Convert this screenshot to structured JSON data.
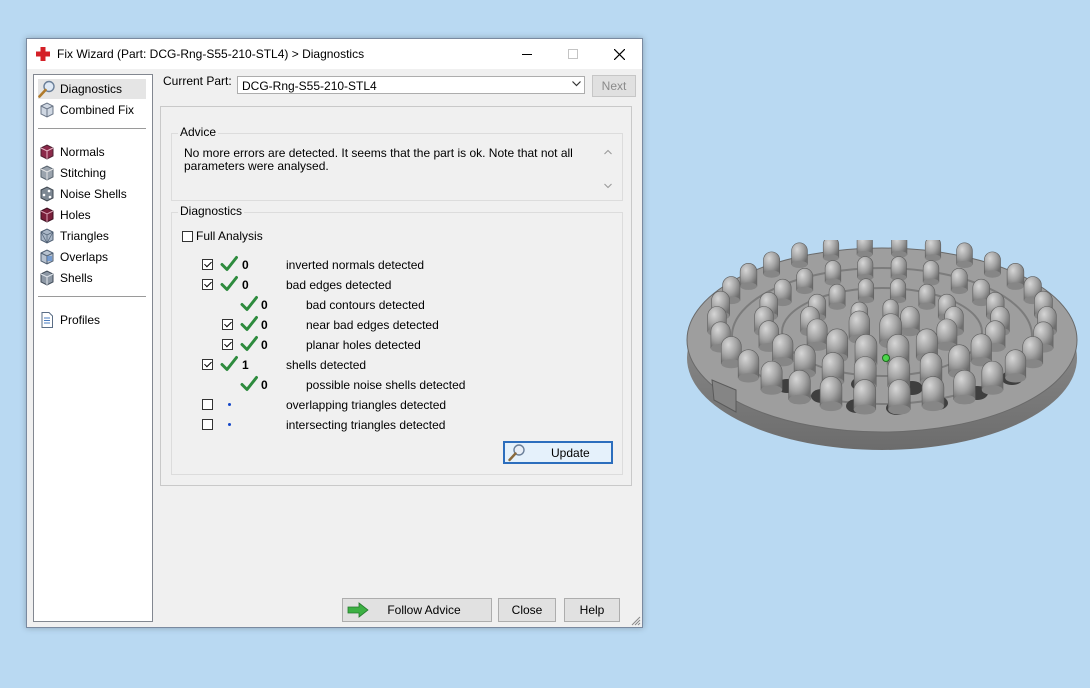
{
  "window": {
    "title": "Fix Wizard (Part: DCG-Rng-S55-210-STL4) > Diagnostics",
    "icon": "red-cross-icon",
    "controls": {
      "minimize": "minimize-icon",
      "maximize": "maximize-icon",
      "close": "close-icon"
    }
  },
  "sidebar": {
    "items": [
      {
        "label": "Diagnostics",
        "icon": "magnifier-icon",
        "selected": true
      },
      {
        "label": "Combined Fix",
        "icon": "cube-icon"
      },
      {
        "label": "Normals",
        "icon": "cube-icon"
      },
      {
        "label": "Stitching",
        "icon": "cube-icon"
      },
      {
        "label": "Noise Shells",
        "icon": "cube-icon"
      },
      {
        "label": "Holes",
        "icon": "cube-icon"
      },
      {
        "label": "Triangles",
        "icon": "cube-icon"
      },
      {
        "label": "Overlaps",
        "icon": "cube-icon"
      },
      {
        "label": "Shells",
        "icon": "cube-icon"
      },
      {
        "label": "Profiles",
        "icon": "document-icon"
      }
    ]
  },
  "current_part": {
    "label": "Current Part:",
    "value": "DCG-Rng-S55-210-STL4",
    "next_label": "Next"
  },
  "advice": {
    "group_label": "Advice",
    "text": "No more errors are detected. It seems that the part is ok. Note that not all parameters were analysed."
  },
  "diagnostics": {
    "group_label": "Diagnostics",
    "full_analysis_label": "Full Analysis",
    "full_analysis_checked": false,
    "rows": [
      {
        "checkbox": true,
        "checked": true,
        "status": "ok",
        "count": "0",
        "label": "inverted normals detected",
        "indent": 0
      },
      {
        "checkbox": true,
        "checked": true,
        "status": "ok",
        "count": "0",
        "label": "bad edges detected",
        "indent": 0
      },
      {
        "checkbox": false,
        "checked": false,
        "status": "ok",
        "count": "0",
        "label": "bad contours detected",
        "indent": 1
      },
      {
        "checkbox": true,
        "checked": true,
        "status": "ok",
        "count": "0",
        "label": "near bad edges detected",
        "indent": 1
      },
      {
        "checkbox": true,
        "checked": true,
        "status": "ok",
        "count": "0",
        "label": "planar holes detected",
        "indent": 1
      },
      {
        "checkbox": true,
        "checked": true,
        "status": "ok",
        "count": "1",
        "label": "shells detected",
        "indent": 0
      },
      {
        "checkbox": false,
        "checked": false,
        "status": "ok",
        "count": "0",
        "label": "possible noise shells detected",
        "indent": 1
      },
      {
        "checkbox": true,
        "checked": false,
        "status": "pending",
        "count": "",
        "label": "overlapping triangles detected",
        "indent": 0
      },
      {
        "checkbox": true,
        "checked": false,
        "status": "pending",
        "count": "",
        "label": "intersecting triangles detected",
        "indent": 0
      }
    ],
    "update_label": "Update"
  },
  "buttons": {
    "follow_advice": "Follow Advice",
    "close": "Close",
    "help": "Help"
  },
  "colors": {
    "desktop": "#b9d9f2",
    "ok_tick": "#2e8b3e",
    "pending_dot": "#1447c8",
    "accent_border": "#2c6ebd",
    "follow_arrow": "#3cb043",
    "part_gray": "#a8a8a8"
  },
  "viewport": {
    "object": "ring-with-pin-supports-3d-part"
  }
}
